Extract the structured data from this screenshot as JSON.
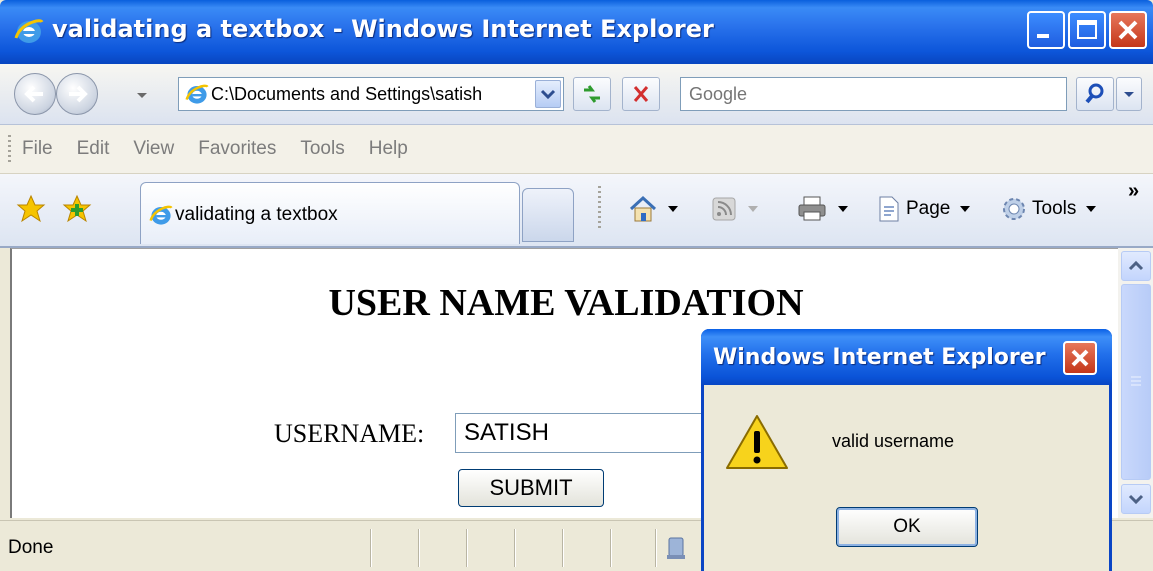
{
  "window": {
    "title": "validating a textbox - Windows Internet Explorer"
  },
  "navbar": {
    "address": "C:\\Documents and Settings\\satish",
    "search_placeholder": "Google"
  },
  "menubar": {
    "items": [
      "File",
      "Edit",
      "View",
      "Favorites",
      "Tools",
      "Help"
    ]
  },
  "tabbar": {
    "tab_label": "validating a textbox",
    "page_label": "Page",
    "tools_label": "Tools",
    "chevron": "»"
  },
  "page": {
    "heading": "USER NAME VALIDATION",
    "username_label": "USERNAME:",
    "username_value": "SATISH",
    "submit_label": "SUBMIT"
  },
  "statusbar": {
    "status": "Done"
  },
  "dialog": {
    "title": "Windows Internet Explorer",
    "message": "valid username",
    "ok_label": "OK"
  },
  "colors": {
    "titlebar": "#0A5FDD",
    "dialog_border": "#0A45C5",
    "close_button": "#C4371A",
    "chrome": "#ECE9D8"
  },
  "icons": [
    "ie-logo-icon",
    "minimize-icon",
    "maximize-icon",
    "close-icon",
    "back-icon",
    "forward-icon",
    "refresh-icon",
    "stop-icon",
    "search-icon",
    "favorites-star-icon",
    "add-favorite-icon",
    "home-icon",
    "feeds-icon",
    "print-icon",
    "page-icon",
    "tools-gear-icon",
    "warning-icon",
    "security-zone-icon"
  ]
}
